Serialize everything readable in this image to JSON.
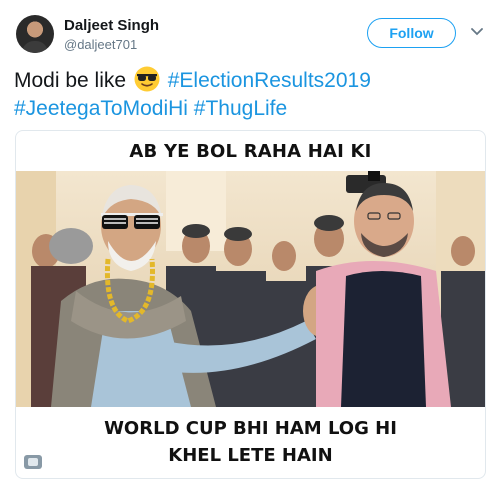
{
  "user": {
    "display_name": "Daljeet Singh",
    "handle": "@daljeet701"
  },
  "header": {
    "follow_label": "Follow",
    "more_icon": "chevron-down-icon"
  },
  "tweet": {
    "text_plain": "Modi be like",
    "emoji": "sunglasses-face",
    "hashtags": [
      "#ElectionResults2019",
      "#JeetegaToModiHi",
      "#ThugLife"
    ]
  },
  "media": {
    "caption_top": "AB YE BOL RAHA HAI KI",
    "caption_bottom_line1": "WORLD CUP BHI HAM LOG HI",
    "caption_bottom_line2": "KHEL LETE HAIN"
  },
  "colors": {
    "accent": "#1da1f2",
    "hashtag": "#1b95e0",
    "text": "#14171a",
    "secondary": "#657786"
  }
}
